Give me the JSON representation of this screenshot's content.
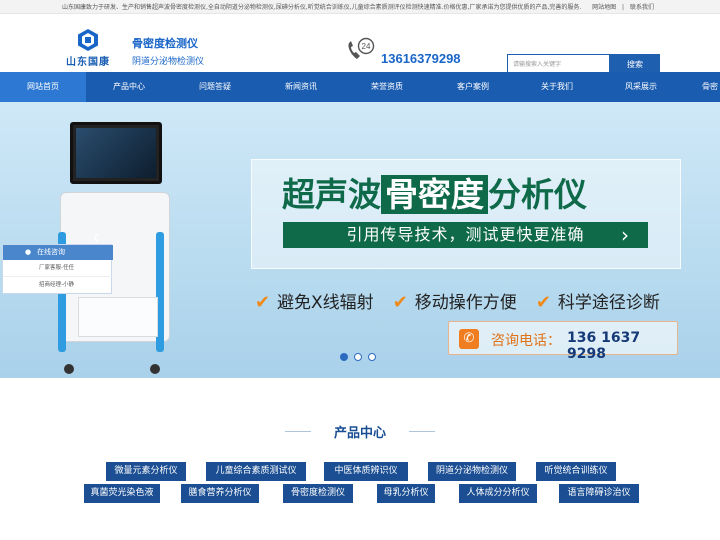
{
  "topbar": {
    "intro": "山东国康致力于研发、生产和销售超声波骨密度检测仪,全自动阴道分泌物检测仪,尿碘分析仪,听觉统合训练仪,儿童综合素质测评仪检测快速精准.价格优惠,厂家承诺为您提供优质的产品,完善的服务.",
    "sitemap": "网站地图",
    "separator": "|",
    "contact": "联系我们"
  },
  "header": {
    "logo_text": "山东国康",
    "slogan_line1": "骨密度检测仪",
    "slogan_line2": "阴道分泌物检测仪",
    "hours_badge": "24",
    "phone": "13616379298",
    "search_placeholder": "请输搜索入关键字",
    "search_button": "搜索"
  },
  "nav": {
    "items": [
      {
        "label": "网站首页",
        "active": true
      },
      {
        "label": "产品中心"
      },
      {
        "label": "问题答疑"
      },
      {
        "label": "新闻资讯"
      },
      {
        "label": "荣誉资质"
      },
      {
        "label": "客户案例"
      },
      {
        "label": "关于我们"
      },
      {
        "label": "风采展示"
      },
      {
        "label": "骨密"
      }
    ]
  },
  "banner": {
    "title_part1": "超声波",
    "title_highlight": "骨密度",
    "title_part3": "分析仪",
    "subtitle": "引用传导技术，测试更快更准确",
    "features": [
      "避免X线辐射",
      "移动操作方便",
      "科学途径诊断"
    ],
    "consult_label": "咨询电话：",
    "consult_phone": "136 1637 9298",
    "slide_count": 3,
    "active_slide": 1,
    "accent_color": "#0f6a4a"
  },
  "chat": {
    "title": "在线咨询",
    "agents": [
      "厂家客服-任任",
      "招商经理-小静"
    ]
  },
  "products": {
    "title": "产品中心",
    "row1": [
      "微量元素分析仪",
      "儿童综合素质测试仪",
      "中医体质辨识仪",
      "阴道分泌物检测仪",
      "听觉统合训练仪"
    ],
    "row2": [
      "真菌荧光染色液",
      "膳食营养分析仪",
      "骨密度检测仪",
      "母乳分析仪",
      "人体成分分析仪",
      "语言障碍诊治仪"
    ]
  },
  "colors": {
    "nav_bg": "#1a5cb0",
    "brand_blue": "#1a66c8",
    "tag_bg": "#1b4e92"
  }
}
